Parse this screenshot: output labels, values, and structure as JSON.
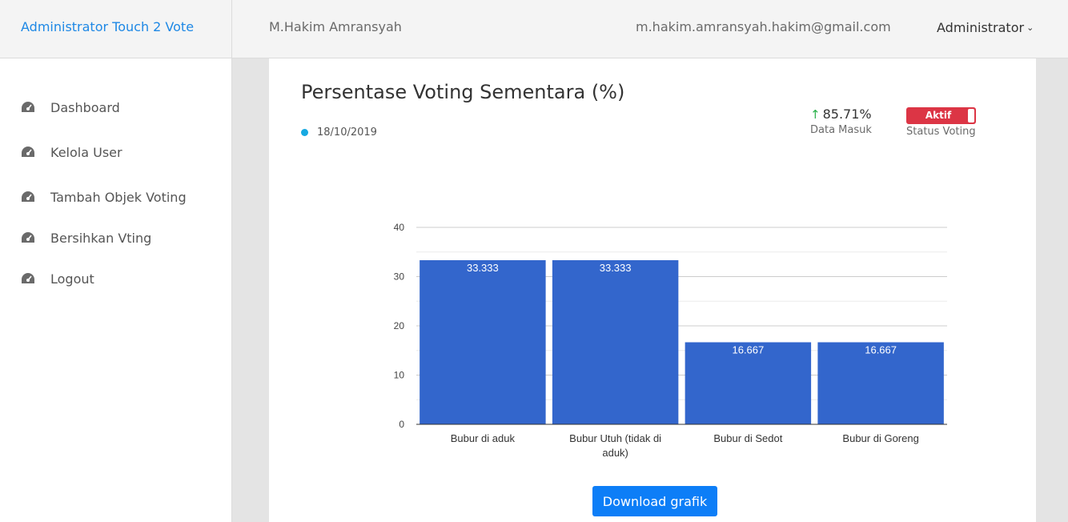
{
  "header": {
    "brand": "Administrator Touch 2 Vote",
    "user_name": "M.Hakim Amransyah",
    "email": "m.hakim.amransyah.hakim@gmail.com",
    "role": "Administrator"
  },
  "sidebar": {
    "items": [
      {
        "label": "Dashboard",
        "icon": "dashboard-icon"
      },
      {
        "label": "Kelola User",
        "icon": "dashboard-icon"
      },
      {
        "label": "Tambah Objek Voting",
        "icon": "dashboard-icon"
      },
      {
        "label": "Bersihkan Vting",
        "icon": "dashboard-icon"
      },
      {
        "label": "Logout",
        "icon": "dashboard-icon"
      }
    ]
  },
  "main": {
    "title": "Persentase Voting Sementara (%)",
    "date": "18/10/2019",
    "data_masuk_value": "85.71%",
    "data_masuk_label": "Data Masuk",
    "status_toggle_label": "Aktif",
    "status_label": "Status Voting",
    "download_label": "Download grafik"
  },
  "colors": {
    "accent": "#1e88e5",
    "bar": "#3366cc",
    "status_active": "#dc3545",
    "button": "#0d7ef7",
    "up_arrow": "#2bb24c",
    "date_dot": "#17a9e1"
  },
  "chart_data": {
    "type": "bar",
    "title": "",
    "xlabel": "",
    "ylabel": "",
    "categories": [
      "Bubur di aduk",
      "Bubur Utuh (tidak di aduk)",
      "Bubur di Sedot",
      "Bubur di Goreng"
    ],
    "values": [
      33.333,
      33.333,
      16.667,
      16.667
    ],
    "value_labels": [
      "33.333",
      "33.333",
      "16.667",
      "16.667"
    ],
    "ylim": [
      0,
      40
    ],
    "yticks": [
      0,
      10,
      20,
      30,
      40
    ],
    "grid": true
  }
}
